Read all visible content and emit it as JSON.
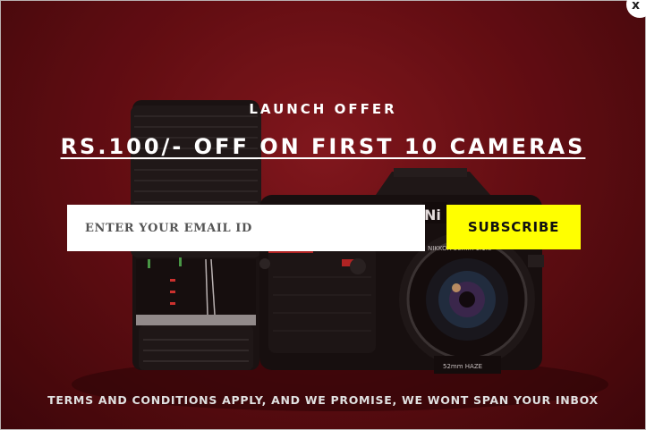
{
  "popup": {
    "eyebrow": "LAUNCH OFFER",
    "headline": "RS.100/- OFF ON FIRST 10 CAMERAS",
    "email_placeholder": "ENTER YOUR EMAIL ID",
    "subscribe_label": "SUBSCRIBE",
    "terms": "TERMS AND CONDITIONS APPLY, AND WE PROMISE, WE WONT SPAN YOUR INBOX",
    "close_label": "x"
  },
  "camera": {
    "brand_text": "Ni",
    "lens_text": "NIKKOR 50mm 1:1.8",
    "filter_text": "52mm HAZE"
  },
  "colors": {
    "background": "#6a0f15",
    "accent_button": "#ffff00",
    "text": "#ffffff"
  }
}
